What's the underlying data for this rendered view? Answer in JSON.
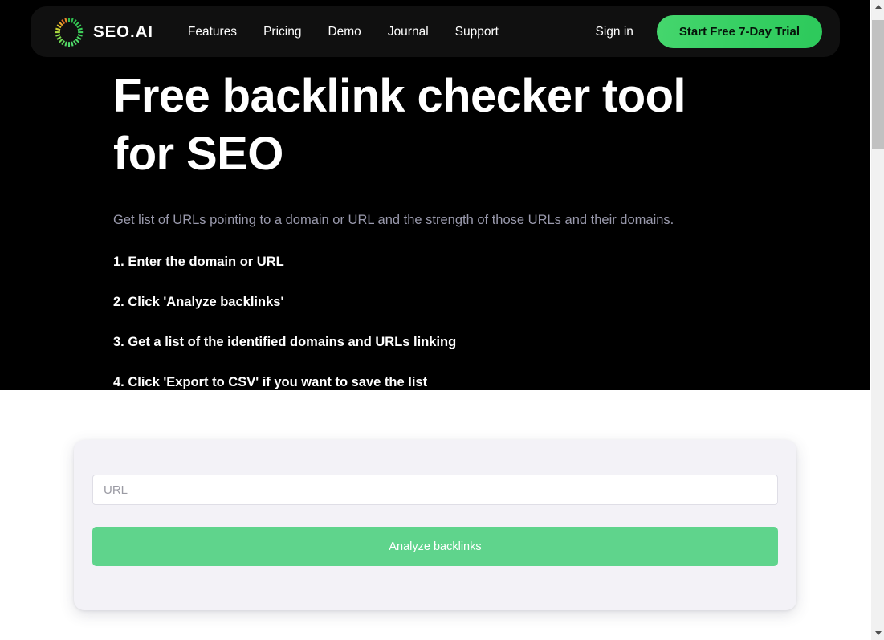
{
  "nav": {
    "brand": {
      "name": "SEO.AI",
      "logo_icon": "sunburst-spinner-icon",
      "logo_colors": [
        "#2fbf4f",
        "#4fd86a",
        "#8ede4a",
        "#c9cf33",
        "#e8a32a",
        "#e8761f"
      ]
    },
    "links": [
      {
        "label": "Features"
      },
      {
        "label": "Pricing"
      },
      {
        "label": "Demo"
      },
      {
        "label": "Journal"
      },
      {
        "label": "Support"
      }
    ],
    "signin_label": "Sign in",
    "cta_label": "Start Free 7-Day Trial",
    "cta_color": "#35cf62",
    "background": "#101010"
  },
  "hero": {
    "title_line1": "Free backlink checker tool",
    "title_line2": "for SEO",
    "subtitle": "Get list of URLs pointing to a domain or URL and the strength of those URLs and their domains.",
    "steps": [
      {
        "text": "1. Enter the domain or URL"
      },
      {
        "text": "2. Click 'Analyze backlinks'"
      },
      {
        "text": "3. Get a list of the identified domains and URLs linking"
      },
      {
        "text": "4. Click 'Export to CSV' if you want to save the list"
      }
    ],
    "background": "#000000",
    "text_color": "#ffffff",
    "subtitle_color": "#9a9aad"
  },
  "tool": {
    "url_placeholder": "URL",
    "url_value": "",
    "analyze_label": "Analyze backlinks",
    "analyze_color": "#5fd48c",
    "card_background": "#f3f2f7"
  },
  "scrollbar": {
    "up_arrow_icon": "chevron-up-icon",
    "down_arrow_icon": "chevron-down-icon"
  }
}
